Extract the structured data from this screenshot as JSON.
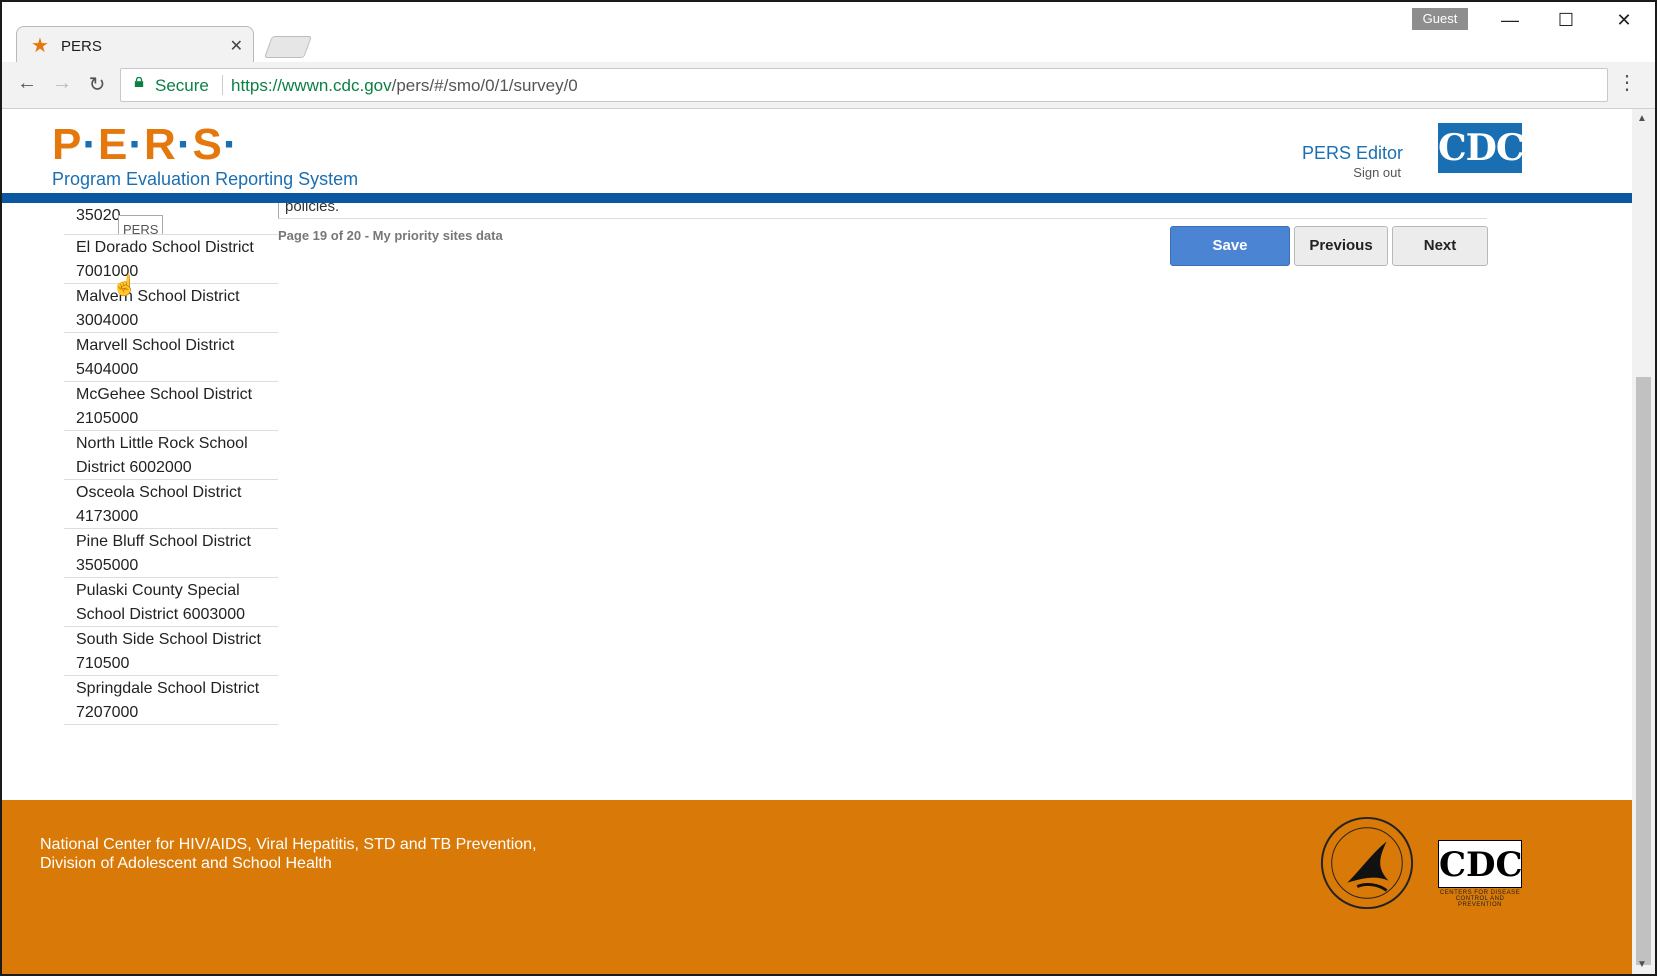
{
  "browser": {
    "tab_title": "PERS",
    "profile_label": "Guest",
    "secure_label": "Secure",
    "url_host": "https://wwwn.cdc.gov",
    "url_path": "/pers/#/smo/0/1/survey/0"
  },
  "header": {
    "logo_letters": [
      "P",
      "E",
      "R",
      "S"
    ],
    "logo_subtitle": "Program Evaluation Reporting System",
    "editor_label": "PERS Editor",
    "signout_label": "Sign out",
    "cdc_logo_text": "CDC"
  },
  "sidebar": {
    "tooltip": "PERS",
    "items": [
      {
        "label": "35020"
      },
      {
        "label": "El Dorado School District 7001000"
      },
      {
        "label": "Malvern School District 3004000"
      },
      {
        "label": "Marvell School District 5404000"
      },
      {
        "label": "McGehee School District 2105000"
      },
      {
        "label": "North Little Rock School District 6002000"
      },
      {
        "label": "Osceola School District 4173000"
      },
      {
        "label": "Pine Bluff School District 3505000"
      },
      {
        "label": "Pulaski County Special School District 6003000"
      },
      {
        "label": "South Side School District 710500"
      },
      {
        "label": "Springdale School District 7207000"
      }
    ]
  },
  "main": {
    "content_tail": "policies.",
    "page_info": "Page 19 of 20 - My priority sites data",
    "save_label": "Save",
    "previous_label": "Previous",
    "next_label": "Next"
  },
  "footer": {
    "line1": "National Center for HIV/AIDS, Viral Hepatitis, STD and TB Prevention,",
    "line2": "Division of Adolescent and School Health",
    "cdc_logo_text": "CDC",
    "cdc_tagline": "CENTERS FOR DISEASE CONTROL AND PREVENTION"
  },
  "colors": {
    "brand_orange": "#d97907",
    "brand_blue": "#1a6fb3",
    "save_blue": "#4a84d2"
  }
}
